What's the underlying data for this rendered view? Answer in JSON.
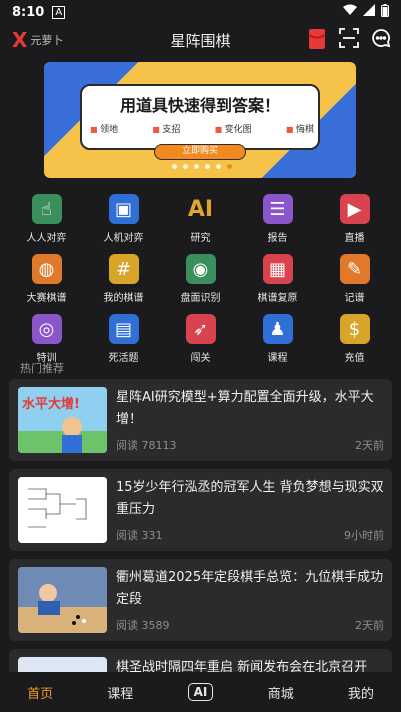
{
  "status": {
    "time": "8:10"
  },
  "header": {
    "logo_mark": "X",
    "logo_text": "元萝卜",
    "title": "星阵围棋"
  },
  "banner": {
    "headline": "用道具快速得到答案！",
    "features": [
      "领地",
      "支招",
      "变化图",
      "悔棋"
    ],
    "cta": "立即购买",
    "colors": {
      "yellow": "#f6c34a",
      "blue": "#3a6fd8",
      "orange": "#f28a1f"
    }
  },
  "grid": [
    {
      "label": "人人对弈",
      "icon": "hand-pointer-icon",
      "color": "#3a8f5c"
    },
    {
      "label": "人机对弈",
      "icon": "robot-screen-icon",
      "color": "#2f6fd6"
    },
    {
      "label": "研究",
      "icon": "ai-icon",
      "color": "#e0a52a"
    },
    {
      "label": "报告",
      "icon": "report-doc-icon",
      "color": "#8a56c9"
    },
    {
      "label": "直播",
      "icon": "video-camera-icon",
      "color": "#d9434d"
    },
    {
      "label": "大赛棋谱",
      "icon": "globe-board-icon",
      "color": "#e07a2a"
    },
    {
      "label": "我的棋谱",
      "icon": "board-grid-icon",
      "color": "#d9a42a"
    },
    {
      "label": "盘面识别",
      "icon": "camera-icon",
      "color": "#3a8f5c"
    },
    {
      "label": "棋谱复原",
      "icon": "board-camera-icon",
      "color": "#d9434d"
    },
    {
      "label": "记谱",
      "icon": "board-pen-icon",
      "color": "#e07a2a"
    },
    {
      "label": "特训",
      "icon": "target-icon",
      "color": "#8a56c9"
    },
    {
      "label": "死活题",
      "icon": "book-icon",
      "color": "#2f6fd6"
    },
    {
      "label": "闯关",
      "icon": "rocket-icon",
      "color": "#d9434d"
    },
    {
      "label": "课程",
      "icon": "teacher-icon",
      "color": "#2f6fd6"
    },
    {
      "label": "充值",
      "icon": "money-bag-icon",
      "color": "#d9a42a"
    }
  ],
  "section": {
    "title": "热门推荐"
  },
  "news": [
    {
      "title": "星阵AI研究模型+算力配置全面升级，水平大增！",
      "reads": "阅读 78113",
      "time": "2天前",
      "thumb_text": "水平大增!"
    },
    {
      "title": "15岁少年行泓丞的冠军人生 背负梦想与现实双重压力",
      "reads": "阅读 331",
      "time": "9小时前"
    },
    {
      "title": "衢州葛道2025年定段棋手总览：九位棋手成功定段",
      "reads": "阅读 3589",
      "time": "2天前"
    },
    {
      "title": "棋圣战时隔四年重启 新闻发布会在北京召开"
    }
  ],
  "nav": {
    "items": [
      "首页",
      "课程",
      "AI",
      "商城",
      "我的"
    ],
    "active_color": "#f29a27"
  }
}
